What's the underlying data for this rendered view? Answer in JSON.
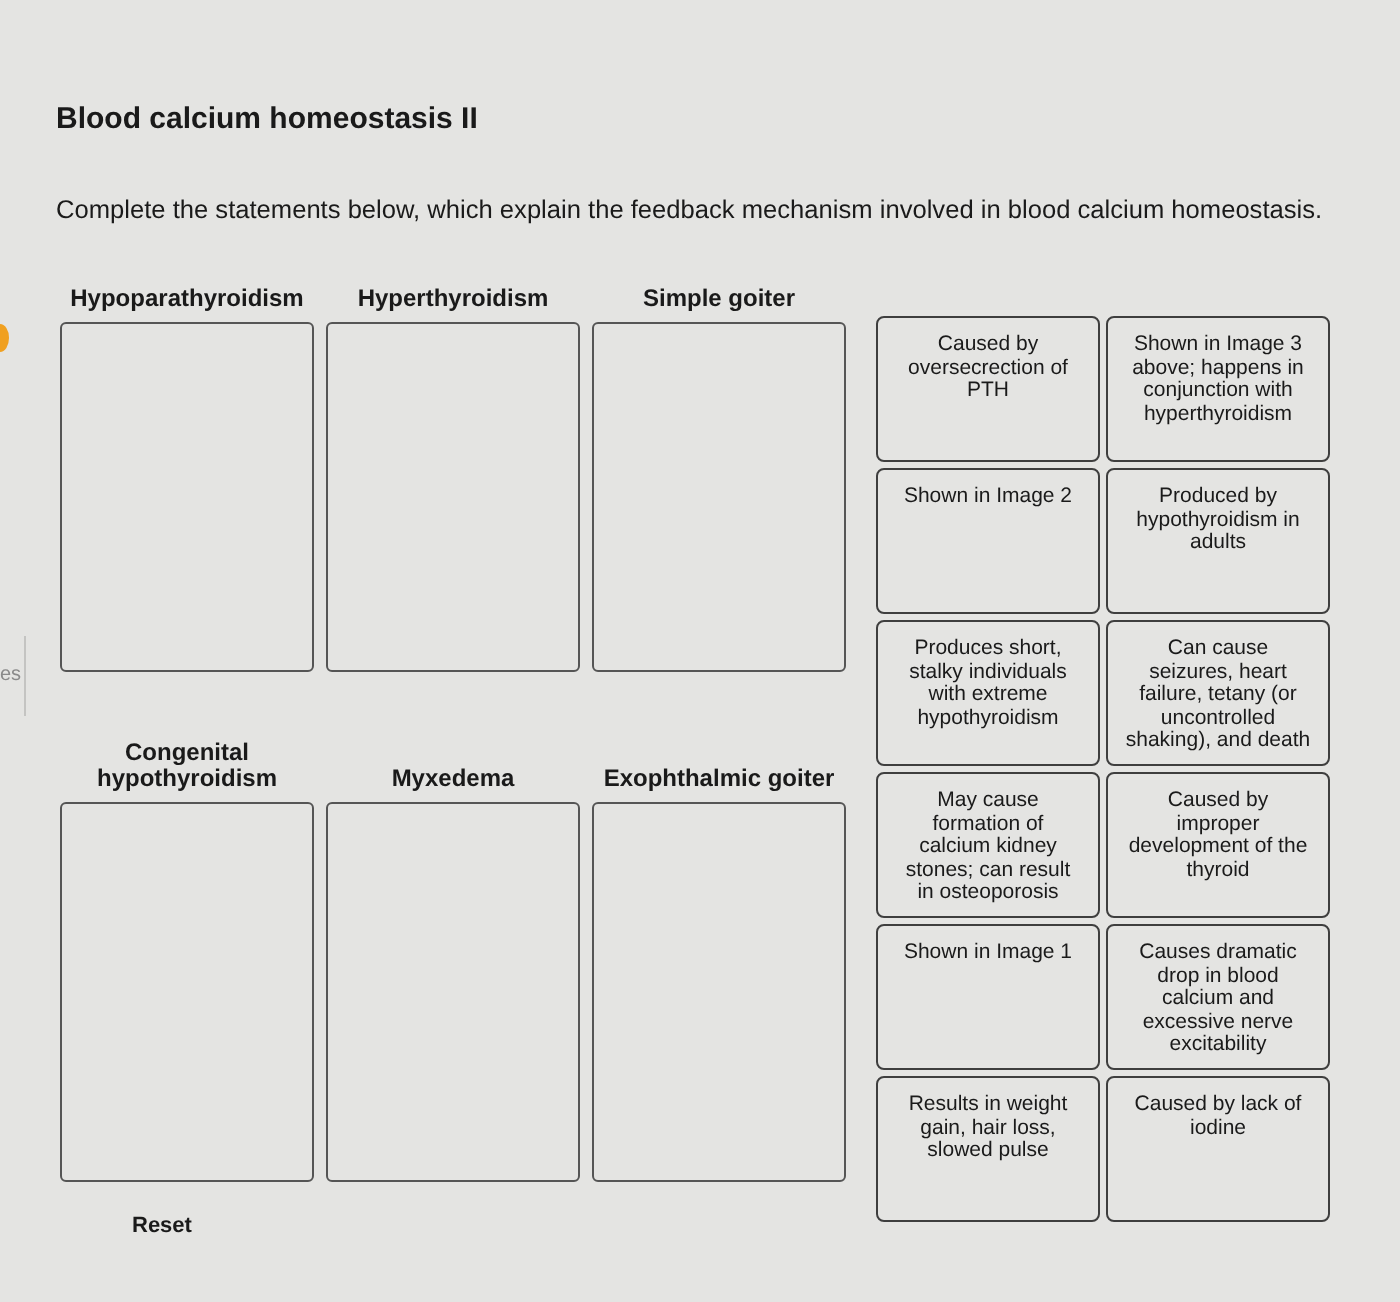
{
  "title": "Blood calcium homeostasis II",
  "instructions": "Complete the statements below, which explain the feedback mechanism involved in blood calcium homeostasis.",
  "side_tab": {
    "label": "es"
  },
  "targets": [
    {
      "label": "Hypoparathyroidism"
    },
    {
      "label": "Hyperthyroidism"
    },
    {
      "label": "Simple goiter"
    },
    {
      "label": "Congenital hypothyroidism"
    },
    {
      "label": "Myxedema"
    },
    {
      "label": "Exophthalmic goiter"
    }
  ],
  "cards": [
    "Caused by oversecrection of PTH",
    "Shown in Image 3 above; happens in conjunction with hyperthyroidism",
    "Shown in Image 2",
    "Produced by hypothyroidism in adults",
    "Produces short, stalky individuals with extreme hypothyroidism",
    "Can cause seizures, heart failure, tetany (or uncontrolled shaking), and death",
    "May cause formation of calcium kidney stones; can result in osteoporosis",
    "Caused by improper development of the thyroid",
    "Shown in Image 1",
    "Causes dramatic drop in blood calcium and excessive nerve excitability",
    "Results in weight gain, hair loss, slowed pulse",
    "Caused by lack of iodine"
  ],
  "reset_button": {
    "label": "Reset"
  }
}
